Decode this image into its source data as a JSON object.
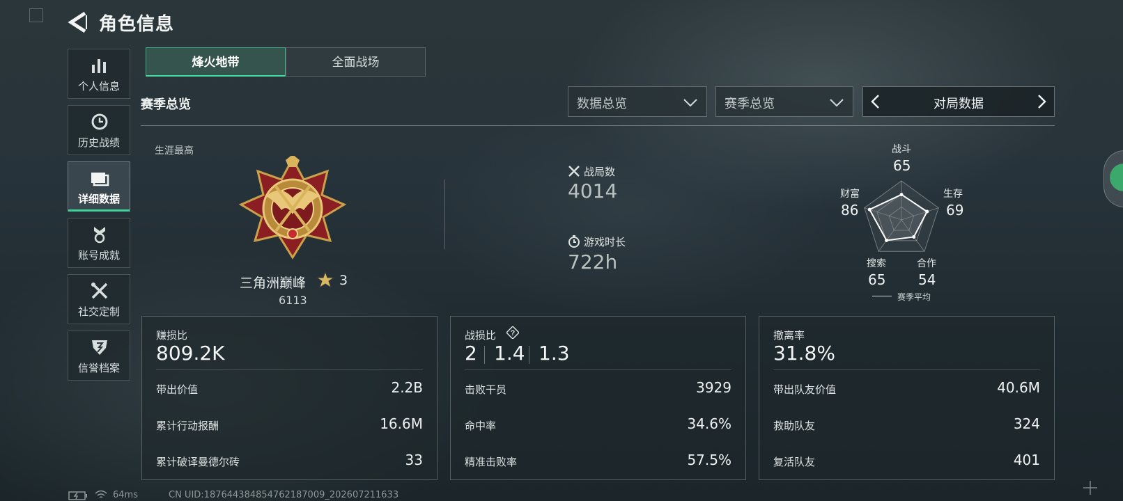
{
  "header": {
    "title": "角色信息"
  },
  "sidebar": {
    "items": [
      {
        "label": "个人信息",
        "icon": "bar-chart-icon"
      },
      {
        "label": "历史战绩",
        "icon": "clock-icon"
      },
      {
        "label": "详细数据",
        "icon": "folder-icon",
        "active": true
      },
      {
        "label": "账号成就",
        "icon": "medal-icon"
      },
      {
        "label": "社交定制",
        "icon": "tools-icon"
      },
      {
        "label": "信誉档案",
        "icon": "shield-icon"
      }
    ]
  },
  "mode_tabs": [
    {
      "label": "烽火地带",
      "active": true
    },
    {
      "label": "全面战场",
      "active": false
    }
  ],
  "section": {
    "title": "赛季总览"
  },
  "filters": {
    "data_scope": "数据总览",
    "season": "赛季总览",
    "view": "对局数据"
  },
  "career": {
    "label": "生涯最高",
    "rank_name": "三角洲巅峰",
    "rank_stars": "3",
    "rank_score": "6113"
  },
  "stats": {
    "matches": {
      "label": "战局数",
      "value": "4014",
      "icon": "crossed-swords-icon"
    },
    "playtime": {
      "label": "游戏时长",
      "value": "722h",
      "icon": "stopwatch-icon"
    }
  },
  "radar": {
    "axes": [
      {
        "label": "战斗",
        "value": "65"
      },
      {
        "label": "生存",
        "value": "69"
      },
      {
        "label": "合作",
        "value": "54"
      },
      {
        "label": "搜索",
        "value": "65"
      },
      {
        "label": "财富",
        "value": "86"
      }
    ],
    "legend": "赛季平均"
  },
  "cards": {
    "profit": {
      "title": "赚损比",
      "value": "809.2K",
      "rows": [
        {
          "label": "带出价值",
          "value": "2.2B"
        },
        {
          "label": "累计行动报酬",
          "value": "16.6M"
        },
        {
          "label": "累计破译曼德尔砖",
          "value": "33"
        }
      ]
    },
    "kd": {
      "title": "战损比",
      "help": "?",
      "values": [
        "2",
        "1.4",
        "1.3"
      ],
      "rows": [
        {
          "label": "击败干员",
          "value": "3929"
        },
        {
          "label": "命中率",
          "value": "34.6%"
        },
        {
          "label": "精准击败率",
          "value": "57.5%"
        }
      ]
    },
    "extract": {
      "title": "撤离率",
      "value": "31.8%",
      "rows": [
        {
          "label": "带出队友价值",
          "value": "40.6M"
        },
        {
          "label": "救助队友",
          "value": "324"
        },
        {
          "label": "复活队友",
          "value": "401"
        }
      ]
    }
  },
  "footer": {
    "ping": "64ms",
    "uid": "CN UID:1876443848547621870​09_202607211633"
  },
  "colors": {
    "accent": "#3fd39a",
    "tab_active_bg": "#36564e"
  }
}
